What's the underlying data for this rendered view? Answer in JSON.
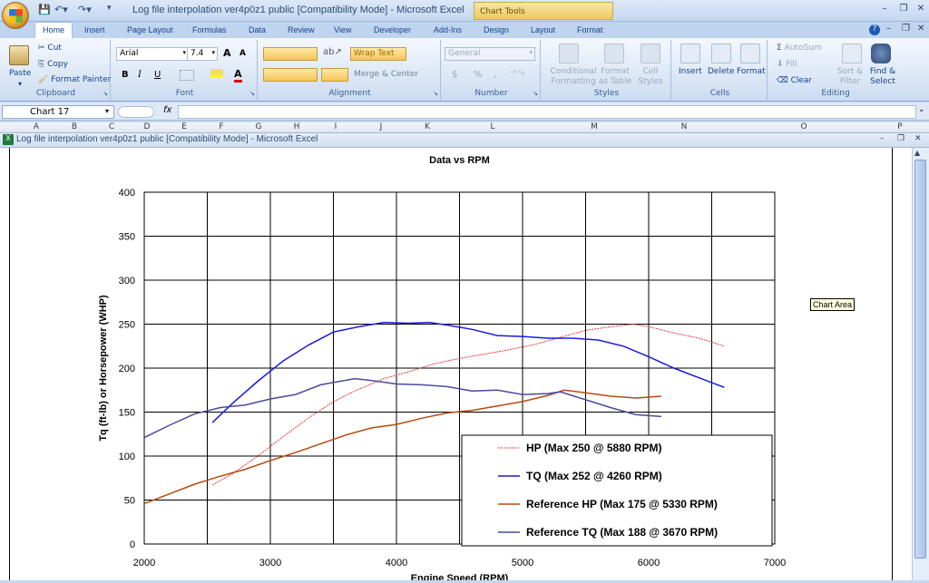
{
  "titlebar": {
    "title": "Log file interpolation ver4p0z1 public  [Compatibility Mode] - Microsoft Excel",
    "context_tab": "Chart Tools",
    "min": "–",
    "max": "❐",
    "close": "✕"
  },
  "tabs": [
    "Home",
    "Insert",
    "Page Layout",
    "Formulas",
    "Data",
    "Review",
    "View",
    "Developer",
    "Add-Ins",
    "Design",
    "Layout",
    "Format"
  ],
  "clipboard": {
    "paste": "Paste",
    "cut": "Cut",
    "copy": "Copy",
    "format_painter": "Format Painter",
    "group": "Clipboard"
  },
  "font": {
    "name": "Arial",
    "size": "7.4",
    "bold": "B",
    "italic": "I",
    "underline": "U",
    "grow": "A",
    "shrink": "A",
    "color_glyph": "A",
    "group": "Font"
  },
  "alignment": {
    "wrap": "Wrap Text",
    "merge": "Merge & Center",
    "group": "Alignment"
  },
  "number": {
    "format": "General",
    "currency": "$",
    "percent": "%",
    "comma": ",",
    "group": "Number"
  },
  "styles": {
    "conditional": "Conditional Formatting",
    "format_table": "Format as Table",
    "cell_styles": "Cell Styles",
    "group": "Styles"
  },
  "cells": {
    "insert": "Insert",
    "delete": "Delete",
    "format": "Format",
    "group": "Cells"
  },
  "editing": {
    "autosum": "AutoSum",
    "fill": "Fill",
    "clear": "Clear",
    "sort": "Sort & Filter",
    "find": "Find & Select",
    "group": "Editing"
  },
  "formula_bar": {
    "name_box": "Chart 17",
    "fx": "fx",
    "value": ""
  },
  "columns": [
    "A",
    "B",
    "C",
    "D",
    "E",
    "F",
    "G",
    "H",
    "I",
    "J",
    "K",
    "L",
    "M",
    "N",
    "O",
    "P"
  ],
  "workbook": {
    "title": "Log file interpolation ver4p0z1 public  [Compatibility Mode] - Microsoft Excel"
  },
  "tooltip": "Chart Area",
  "chart_data": {
    "type": "line",
    "title": "Data vs RPM",
    "xlabel": "Engine Speed (RPM)",
    "ylabel": "Tq (ft-lb) or Horsepower (WHP)",
    "xlim": [
      2000,
      7000
    ],
    "ylim": [
      0,
      400
    ],
    "xticks": [
      2000,
      3000,
      4000,
      5000,
      6000,
      7000
    ],
    "yticks": [
      0,
      50,
      100,
      150,
      200,
      250,
      300,
      350,
      400
    ],
    "grid": true,
    "legend_position": "bottom-right",
    "series": [
      {
        "name": "HP (Max 250 @ 5880 RPM)",
        "color": "#e8393f",
        "dash": "2,1",
        "x": [
          2540,
          2700,
          2900,
          3100,
          3300,
          3500,
          3700,
          3900,
          4100,
          4300,
          4500,
          4700,
          4900,
          5100,
          5300,
          5500,
          5700,
          5880,
          6000,
          6200,
          6400,
          6600
        ],
        "y": [
          67,
          80,
          100,
          122,
          143,
          162,
          176,
          188,
          196,
          205,
          211,
          216,
          221,
          227,
          235,
          243,
          247,
          250,
          247,
          240,
          234,
          225
        ]
      },
      {
        "name": "TQ (Max 252 @ 4260 RPM)",
        "color": "#1a1ae0",
        "dash": "",
        "x": [
          2540,
          2700,
          2900,
          3100,
          3300,
          3500,
          3700,
          3900,
          4100,
          4260,
          4400,
          4600,
          4800,
          5000,
          5200,
          5400,
          5600,
          5800,
          6000,
          6200,
          6400,
          6600
        ],
        "y": [
          138,
          160,
          185,
          208,
          226,
          241,
          247,
          252,
          251,
          252,
          249,
          244,
          237,
          236,
          234,
          234,
          232,
          225,
          213,
          200,
          189,
          178
        ]
      },
      {
        "name": "Reference HP (Max 175 @ 5330 RPM)",
        "color": "#b84a0b",
        "dash": "",
        "x": [
          2000,
          2200,
          2400,
          2600,
          2800,
          3000,
          3200,
          3400,
          3600,
          3800,
          4000,
          4200,
          4400,
          4600,
          4800,
          5000,
          5200,
          5330,
          5500,
          5700,
          5900,
          6100
        ],
        "y": [
          46,
          57,
          68,
          77,
          85,
          95,
          104,
          114,
          124,
          132,
          136,
          143,
          149,
          152,
          157,
          162,
          169,
          175,
          172,
          168,
          166,
          168
        ]
      },
      {
        "name": "Reference TQ (Max 188 @ 3670 RPM)",
        "color": "#4a4a9c",
        "dash": "",
        "x": [
          2000,
          2200,
          2400,
          2600,
          2800,
          3000,
          3200,
          3400,
          3670,
          3800,
          4000,
          4200,
          4400,
          4600,
          4800,
          5000,
          5200,
          5300,
          5500,
          5700,
          5900,
          6100
        ],
        "y": [
          121,
          135,
          148,
          155,
          158,
          165,
          170,
          181,
          188,
          186,
          182,
          181,
          179,
          174,
          175,
          170,
          171,
          173,
          164,
          155,
          147,
          145
        ]
      }
    ]
  }
}
